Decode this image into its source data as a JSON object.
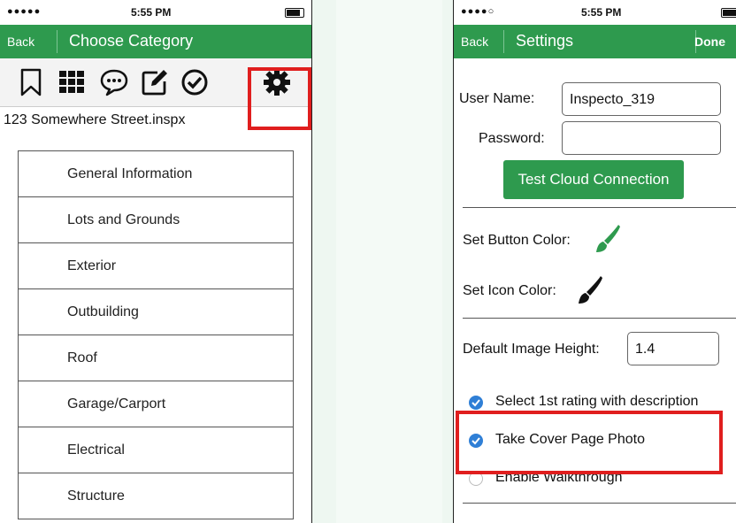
{
  "left": {
    "status": {
      "signal": "●●●●● ",
      "time": "5:55 PM"
    },
    "nav": {
      "back": "Back",
      "title": "Choose Category"
    },
    "toolbar_icons": [
      "bookmark-icon",
      "grid-icon",
      "comment-icon",
      "edit-icon",
      "check-circle-icon",
      "gear-icon"
    ],
    "address": "123 Somewhere Street.inspx",
    "categories": [
      "General Information",
      "Lots and Grounds",
      "Exterior",
      "Outbuilding",
      "Roof",
      "Garage/Carport",
      "Electrical",
      "Structure"
    ]
  },
  "right": {
    "status": {
      "signal": "●●●●○ ",
      "time": "5:55 PM"
    },
    "nav": {
      "back": "Back",
      "title": "Settings",
      "done": "Done"
    },
    "user_label": "User Name:",
    "user_value": "Inspecto_319",
    "password_label": "Password:",
    "password_value": "",
    "cloud_button": "Test Cloud Connection",
    "button_color_label": "Set Button Color:",
    "icon_color_label": "Set Icon Color:",
    "image_height_label": "Default Image Height:",
    "image_height_value": "1.4",
    "options": [
      {
        "label": "Select 1st rating with description",
        "checked": true
      },
      {
        "label": "Take Cover Page Photo",
        "checked": true
      },
      {
        "label": "Enable Walkthrough",
        "checked": false
      }
    ]
  },
  "colors": {
    "accent": "#2e9a4e",
    "highlight": "#e01e1e",
    "check": "#2f7fd6"
  }
}
